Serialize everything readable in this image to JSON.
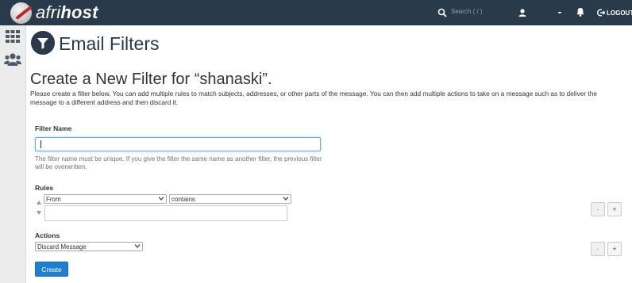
{
  "header": {
    "brand_light": "afri",
    "brand_bold": "host",
    "search_placeholder": "Search ( / )",
    "logout_label": "LOGOUT"
  },
  "page": {
    "title": "Email Filters",
    "subheading": "Create a New Filter for “shanaski”.",
    "description": "Please create a filter below. You can add multiple rules to match subjects, addresses, or other parts of the message. You can then add multiple actions to take on a message such as to deliver the message to a different address and then discard it."
  },
  "form": {
    "filter_name_label": "Filter Name",
    "filter_name_value": "",
    "filter_name_help": "The filter name must be unique. If you give the filter the same name as another filter, the previous filter will be overwritten.",
    "rules_label": "Rules",
    "rule_field": "From",
    "rule_operator": "contains",
    "rule_value": "",
    "actions_label": "Actions",
    "action_value": "Discard Message",
    "minus_label": "-",
    "plus_label": "+",
    "create_label": "Create"
  },
  "colors": {
    "topbar": "#293a4a",
    "primary_button": "#1f7fd1",
    "input_focus": "#66afe9"
  },
  "icons": [
    "search-icon",
    "user-icon",
    "bell-icon",
    "logout-icon",
    "apps-grid-icon",
    "users-icon",
    "filter-icon"
  ]
}
